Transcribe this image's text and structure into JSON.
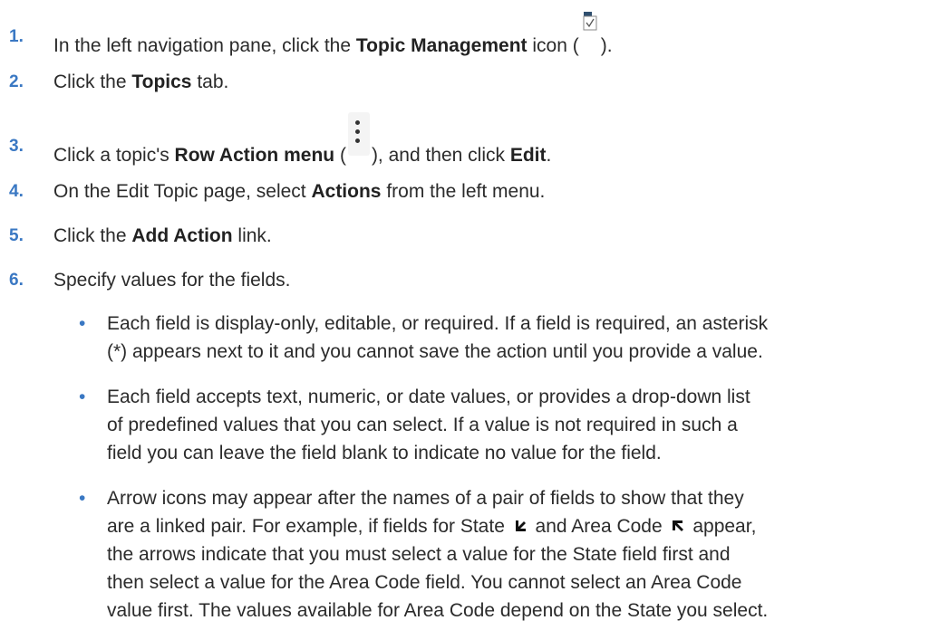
{
  "steps": [
    {
      "num": "1.",
      "pre": "In the left navigation pane, click the ",
      "bold": "Topic Management",
      "mid": " icon (",
      "post": ")."
    },
    {
      "num": "2.",
      "pre": "Click the ",
      "bold": "Topics",
      "post": " tab."
    },
    {
      "num": "3.",
      "pre": "Click a topic's ",
      "bold": "Row Action menu",
      "mid": " (",
      "post": "), and then click ",
      "bold2": "Edit",
      "end": "."
    },
    {
      "num": "4.",
      "pre": "On the Edit Topic page, select ",
      "bold": "Actions",
      "post": " from the left menu."
    },
    {
      "num": "5.",
      "pre": "Click the ",
      "bold": "Add Action",
      "post": " link."
    },
    {
      "num": "6.",
      "text": "Specify values for the fields."
    }
  ],
  "bullets": [
    {
      "dot": "•",
      "lines": [
        "Each field is display-only, editable, or required. If a field is required, an asterisk",
        "(*) appears next to it and you cannot save the action until you provide a value."
      ]
    },
    {
      "dot": "•",
      "lines": [
        "Each field accepts text, numeric, or date values, or provides a drop-down list",
        "of predefined values that you can select. If a value is not required in such a",
        "field you can leave the field blank to indicate no value for the field."
      ]
    },
    {
      "dot": "•",
      "line1": "Arrow icons may appear after the names of a pair of fields to show that they",
      "line2_a": "are a linked pair. For example, if fields for State ",
      "line2_b": " and Area Code ",
      "line2_c": " appear,",
      "lines_rest": [
        "the arrows indicate that you must select a value for the State field first and",
        "then select a value for the Area Code field. You cannot select an Area Code",
        "value first. The values available for Area Code depend on the State you select."
      ]
    }
  ],
  "colors": {
    "accent": "#3a78c3",
    "text": "#2b2b2b"
  },
  "icons": {
    "topic_management": "topic-management-icon",
    "row_action": "kebab-menu-icon",
    "state_arrow": "arrow-down-left-icon",
    "area_code_arrow": "arrow-up-left-icon"
  }
}
